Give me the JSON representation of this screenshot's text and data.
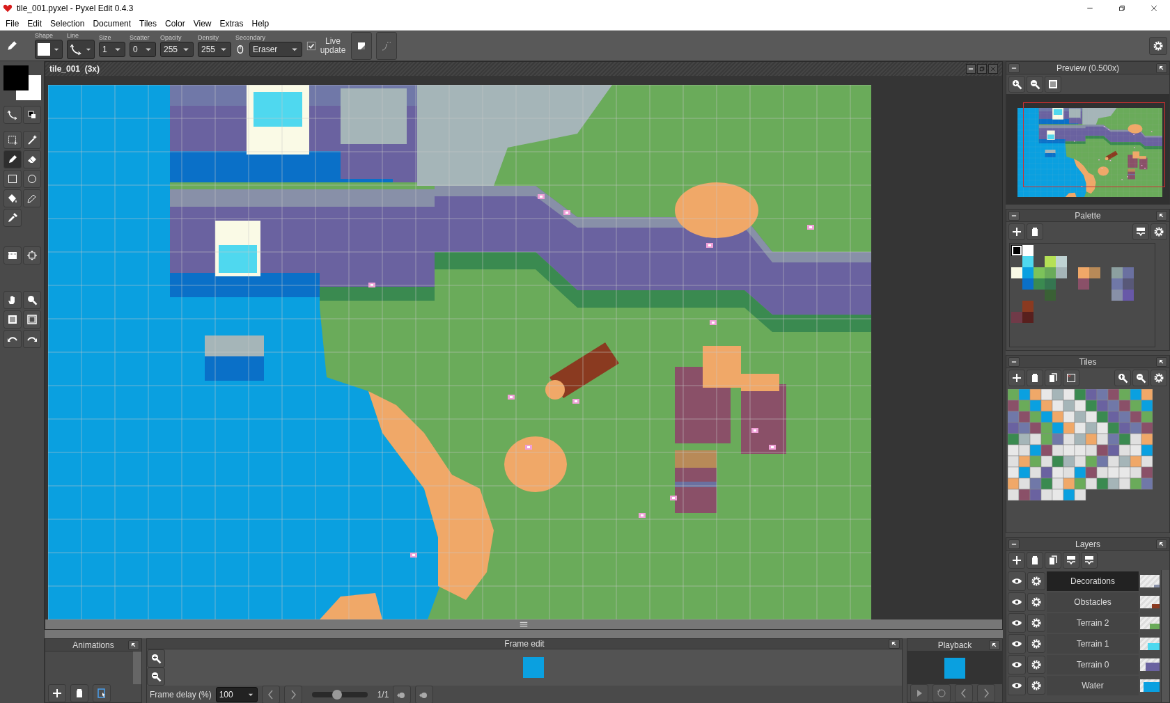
{
  "window": {
    "title": "tile_001.pyxel - Pyxel Edit 0.4.3"
  },
  "menu": [
    "File",
    "Edit",
    "Selection",
    "Document",
    "Tiles",
    "Color",
    "View",
    "Extras",
    "Help"
  ],
  "toolbar": {
    "shape_label": "Shape",
    "line_label": "Line",
    "dropdowns": [
      {
        "label": "Size",
        "value": "1"
      },
      {
        "label": "Scatter",
        "value": "0"
      },
      {
        "label": "Opacity",
        "value": "255"
      },
      {
        "label": "Density",
        "value": "255"
      }
    ],
    "secondary": {
      "label": "Secondary",
      "value": "Eraser"
    },
    "live_update": {
      "label": "Live update",
      "checked": true
    }
  },
  "tool_groups": [
    {
      "tools": [
        {
          "kind": "curve",
          "selected": false
        },
        {
          "kind": "swap",
          "selected": false
        }
      ]
    },
    {
      "tools": [
        {
          "kind": "rect-select",
          "selected": false
        },
        {
          "kind": "wand",
          "selected": false
        },
        {
          "kind": "pencil",
          "selected": true
        },
        {
          "kind": "eraser",
          "selected": false
        },
        {
          "kind": "rect",
          "selected": false
        },
        {
          "kind": "ellipse",
          "selected": false
        },
        {
          "kind": "bucket",
          "selected": false
        },
        {
          "kind": "pen",
          "selected": false
        },
        {
          "kind": "eyedropper",
          "selected": false
        }
      ]
    },
    {
      "tools": [
        {
          "kind": "tile",
          "selected": false
        },
        {
          "kind": "transform",
          "selected": false
        }
      ]
    },
    {
      "tools": [
        {
          "kind": "hand",
          "selected": false
        },
        {
          "kind": "zoom",
          "selected": false
        },
        {
          "kind": "checker",
          "selected": false
        },
        {
          "kind": "frame",
          "selected": false
        },
        {
          "kind": "undo",
          "selected": false
        },
        {
          "kind": "redo",
          "selected": false
        }
      ]
    }
  ],
  "document": {
    "title": "tile_001  (3x)"
  },
  "preview": {
    "title": "Preview (0.500x)"
  },
  "palette": {
    "title": "Palette",
    "rows": [
      [
        {
          "kind": "swatch",
          "color": "#000000",
          "selected": true
        },
        {
          "kind": "swatch",
          "color": "#ffffff",
          "selected": false
        }
      ],
      [
        {
          "kind": "gap"
        },
        {
          "kind": "swatch",
          "color": "#4fd8ef",
          "selected": false
        },
        {
          "kind": "gap"
        },
        {
          "kind": "swatch",
          "color": "#b5e156",
          "selected": false
        },
        {
          "kind": "swatch",
          "color": "#bfd3d3",
          "selected": false
        }
      ],
      [
        {
          "kind": "swatch",
          "color": "#fafae6",
          "selected": false
        },
        {
          "kind": "swatch",
          "color": "#0aa0e0",
          "selected": false
        },
        {
          "kind": "swatch",
          "color": "#7cc35a",
          "selected": false
        },
        {
          "kind": "swatch",
          "color": "#6aab5a",
          "selected": false
        },
        {
          "kind": "swatch",
          "color": "#a5b5b8",
          "selected": false
        },
        {
          "kind": "gap"
        },
        {
          "kind": "swatch",
          "color": "#f0a868",
          "selected": false
        },
        {
          "kind": "swatch",
          "color": "#b88a58",
          "selected": false
        },
        {
          "kind": "gap"
        },
        {
          "kind": "swatch",
          "color": "#8ca0a0",
          "selected": false
        },
        {
          "kind": "swatch",
          "color": "#6a70a0",
          "selected": false
        }
      ],
      [
        {
          "kind": "gap"
        },
        {
          "kind": "swatch",
          "color": "#0a70c8",
          "selected": false
        },
        {
          "kind": "swatch",
          "color": "#3a8a50",
          "selected": false
        },
        {
          "kind": "swatch",
          "color": "#357550",
          "selected": false
        },
        {
          "kind": "gap"
        },
        {
          "kind": "gap"
        },
        {
          "kind": "swatch",
          "color": "#8a5068",
          "selected": false
        },
        {
          "kind": "gap"
        },
        {
          "kind": "gap"
        },
        {
          "kind": "swatch",
          "color": "#7078a8",
          "selected": false
        },
        {
          "kind": "swatch",
          "color": "#585878",
          "selected": false
        }
      ],
      [
        {
          "kind": "gap"
        },
        {
          "kind": "gap"
        },
        {
          "kind": "gap"
        },
        {
          "kind": "swatch",
          "color": "#3a6035",
          "selected": false
        },
        {
          "kind": "gap"
        },
        {
          "kind": "gap"
        },
        {
          "kind": "gap"
        },
        {
          "kind": "gap"
        },
        {
          "kind": "gap"
        },
        {
          "kind": "swatch",
          "color": "#8890a8",
          "selected": false
        },
        {
          "kind": "swatch",
          "color": "#6858a8",
          "selected": false
        }
      ],
      [
        {
          "kind": "gap"
        },
        {
          "kind": "swatch",
          "color": "#8a3a20",
          "selected": false
        }
      ],
      [
        {
          "kind": "swatch",
          "color": "#703a48",
          "selected": false
        },
        {
          "kind": "swatch",
          "color": "#58201e",
          "selected": false
        }
      ]
    ]
  },
  "tiles": {
    "title": "Tiles"
  },
  "layers": {
    "title": "Layers",
    "items": [
      {
        "name": "Decorations",
        "selected": true,
        "visible": true
      },
      {
        "name": "Obstacles",
        "selected": false,
        "visible": true
      },
      {
        "name": "Terrain 2",
        "selected": false,
        "visible": true
      },
      {
        "name": "Terrain 1",
        "selected": false,
        "visible": true
      },
      {
        "name": "Terrain 0",
        "selected": false,
        "visible": true
      },
      {
        "name": "Water",
        "selected": false,
        "visible": true
      }
    ]
  },
  "animations": {
    "title": "Animations"
  },
  "frame_edit": {
    "title": "Frame edit",
    "delay_label": "Frame delay (%)",
    "delay_value": "100",
    "level": 0.45,
    "frame_count": "1/1"
  },
  "playback": {
    "title": "Playback"
  }
}
